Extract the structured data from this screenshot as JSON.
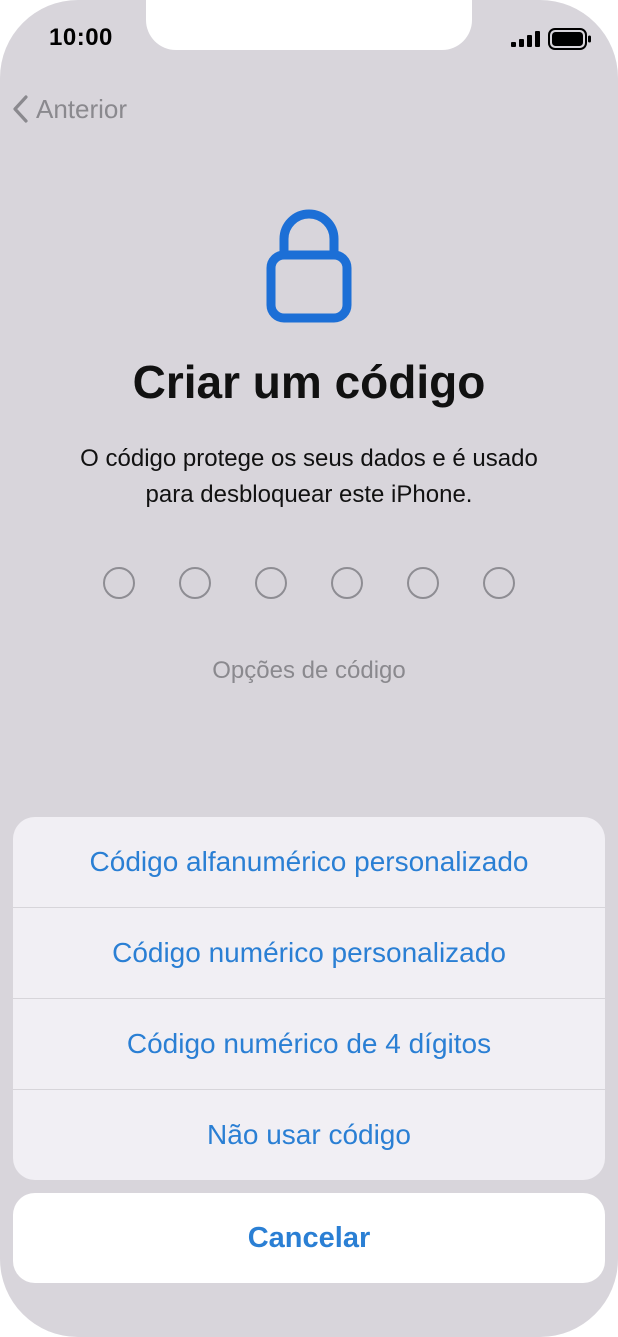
{
  "status_bar": {
    "time": "10:00",
    "signal_icon": "signal-bars-icon",
    "battery_icon": "battery-icon"
  },
  "nav": {
    "back_label": "Anterior",
    "back_icon": "chevron-left-icon"
  },
  "header": {
    "icon": "lock-icon",
    "title": "Criar um código",
    "subtitle_line1": "O código protege os seus dados e é usado",
    "subtitle_line2": "para desbloquear este iPhone."
  },
  "passcode": {
    "digit_count": 6,
    "entered_count": 0
  },
  "options_link": "Opções de código",
  "action_sheet": {
    "items": [
      {
        "label": "Código alfanumérico personalizado"
      },
      {
        "label": "Código numérico personalizado"
      },
      {
        "label": "Código numérico de 4 dígitos"
      },
      {
        "label": "Não usar código"
      }
    ],
    "cancel_label": "Cancelar"
  },
  "colors": {
    "accent": "#2a7fd4",
    "background": "#d8d5db",
    "sheet_background": "#f1eff4",
    "secondary_text": "#8a898e"
  }
}
